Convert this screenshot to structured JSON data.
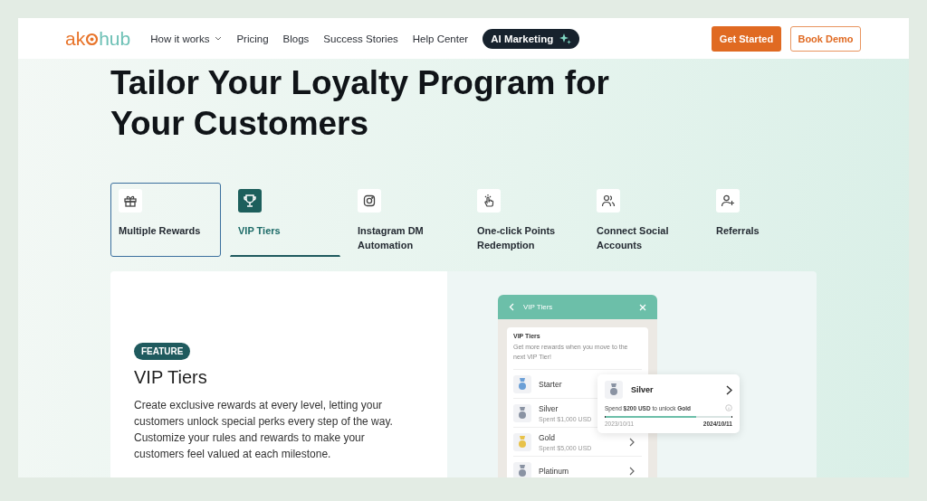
{
  "header": {
    "logo": {
      "part1": "ak",
      "part2": "hub"
    },
    "nav": [
      {
        "label": "How it works",
        "dropdown": true
      },
      {
        "label": "Pricing",
        "dropdown": false
      },
      {
        "label": "Blogs",
        "dropdown": false
      },
      {
        "label": "Success Stories",
        "dropdown": false
      },
      {
        "label": "Help Center",
        "dropdown": false
      }
    ],
    "ai_button": "AI Marketing",
    "get_started": "Get Started",
    "book_demo": "Book Demo"
  },
  "title": "Tailor Your Loyalty Program for Your Customers",
  "tabs": [
    {
      "label": "Multiple Rewards",
      "selected": false,
      "outlined": true
    },
    {
      "label": "VIP Tiers",
      "selected": true,
      "outlined": false
    },
    {
      "label": "Instagram DM Automation",
      "selected": false,
      "outlined": false
    },
    {
      "label": "One-click Points Redemption",
      "selected": false,
      "outlined": false
    },
    {
      "label": "Connect Social Accounts",
      "selected": false,
      "outlined": false
    },
    {
      "label": "Referrals",
      "selected": false,
      "outlined": false
    }
  ],
  "feature": {
    "badge": "FEATURE",
    "heading": "VIP Tiers",
    "body": "Create exclusive rewards at every level, letting your customers unlock special perks every step of the way. Customize your rules and rewards to make your customers feel valued at each milestone."
  },
  "widget": {
    "header": "VIP Tiers",
    "card_title": "VIP Tiers",
    "card_text": "Get more rewards when you move to the next VIP Tier!",
    "tiers": [
      {
        "name": "Starter",
        "color": "#6b9fd6",
        "chevron": false
      },
      {
        "name": "Silver",
        "detail": "Spent $1,000 USD",
        "color": "#8a93a3",
        "chevron": false
      },
      {
        "name": "Gold",
        "detail": "Spent $5,000 USD",
        "color": "#e8c24a",
        "chevron": true
      },
      {
        "name": "Platinum",
        "color": "#8a93a3",
        "chevron": true
      }
    ],
    "popup": {
      "name": "Silver",
      "text": "Spend **$200 USD** to unlock **Gold**",
      "level": 0.72,
      "start": "2023/10/11",
      "end": "2024/10/11"
    }
  }
}
